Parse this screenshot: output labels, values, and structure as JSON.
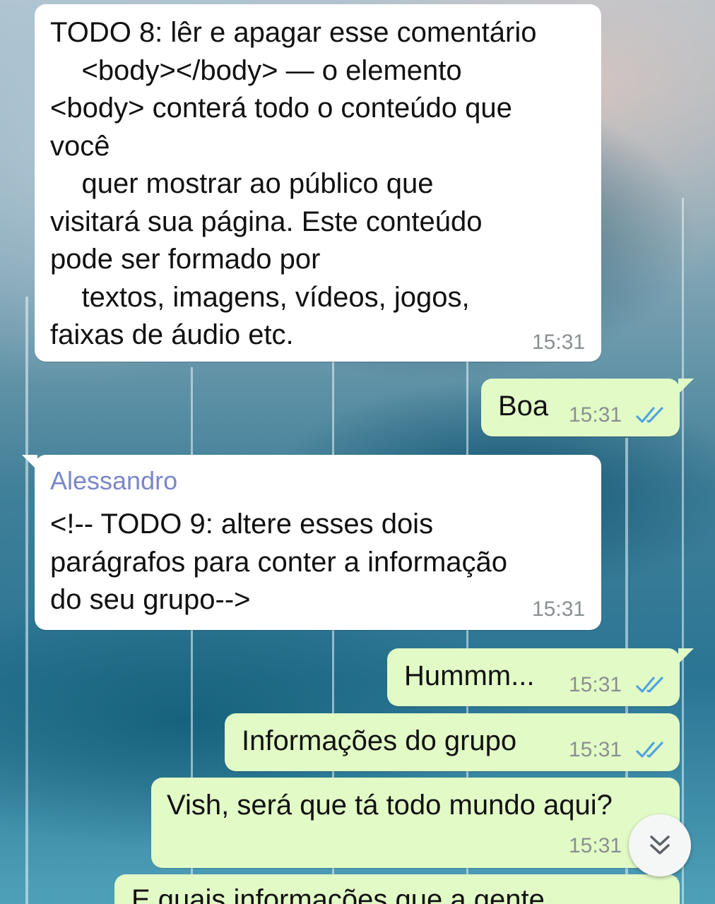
{
  "messages": [
    {
      "direction": "incoming",
      "text": "TODO 8: lêr e apagar esse comentário\n    <body></body> — o elemento\n<body> conterá todo o conteúdo que\nvocê\n    quer mostrar ao público que\nvisitará sua página. Este conteúdo\npode ser formado por\n    textos, imagens, vídeos, jogos,\nfaixas de áudio etc.",
      "time": "15:31"
    },
    {
      "direction": "outgoing",
      "text": "Boa",
      "time": "15:31",
      "status": "read"
    },
    {
      "direction": "incoming",
      "sender": "Alessandro",
      "text": "<!-- TODO 9: altere esses dois\nparágrafos para conter a informação\ndo seu grupo-->",
      "time": "15:31"
    },
    {
      "direction": "outgoing",
      "text": "Hummm...",
      "time": "15:31",
      "status": "read"
    },
    {
      "direction": "outgoing",
      "text": "Informações do grupo",
      "time": "15:31",
      "status": "read"
    },
    {
      "direction": "outgoing",
      "text": "Vish, será que tá todo mundo aqui?",
      "time": "15:31",
      "status": "read"
    },
    {
      "direction": "outgoing",
      "text": "E quais informações que a gente",
      "time": "",
      "status": ""
    }
  ],
  "colors": {
    "incoming_bubble": "#ffffff",
    "outgoing_bubble": "#e2fbc6",
    "sender_name": "#7b86c9",
    "read_ticks": "#4fa3e0",
    "timestamp": "#8a8f92"
  },
  "icons": {
    "read_status": "double-check-icon",
    "scroll_down": "double-chevron-down-icon"
  }
}
